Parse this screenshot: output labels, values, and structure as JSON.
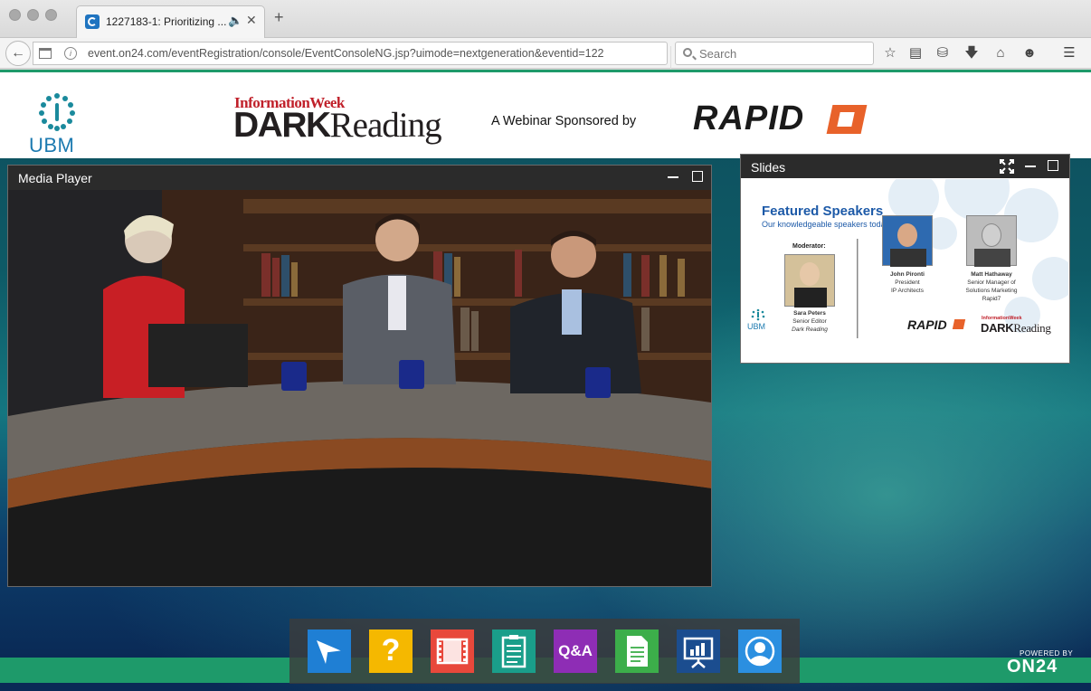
{
  "browser": {
    "tab_title": "1227183-1: Prioritizing ...",
    "tab_audio_icon": "speaker-icon",
    "url": "event.on24.com/eventRegistration/console/EventConsoleNG.jsp?uimode=nextgeneration&eventid=122",
    "search_placeholder": "Search",
    "toolbar_icons": [
      "bookmark-star-icon",
      "reading-list-icon",
      "pocket-icon",
      "downloads-icon",
      "home-icon",
      "emoji-icon",
      "menu-icon"
    ]
  },
  "header": {
    "ubm_label": "UBM",
    "informationweek_label": "InformationWeek",
    "dark_label": "DARK",
    "reading_label": "Reading",
    "sponsor_text": "A Webinar Sponsored by",
    "rapid7_label": "RAPID"
  },
  "media_player": {
    "title": "Media Player"
  },
  "slides": {
    "title": "Slides",
    "slide_title": "Featured Speakers",
    "slide_subtitle": "Our knowledgeable speakers today are:",
    "moderator_label": "Moderator:",
    "speakers": [
      {
        "name": "Sara Peters",
        "line1": "Senior Editor",
        "line2": "Dark Reading"
      },
      {
        "name": "John Pironti",
        "line1": "President",
        "line2": "IP Architects"
      },
      {
        "name": "Matt Hathaway",
        "line1": "Senior Manager of",
        "line2": "Solutions Marketing",
        "line3": "Rapid7"
      }
    ],
    "footer_ubm": "UBM",
    "footer_rapid7": "RAPID",
    "footer_iw": "InformationWeek",
    "footer_dark": "DARK",
    "footer_reading": "Reading"
  },
  "dock": {
    "buttons": [
      {
        "icon": "send-icon",
        "color": "#1f7fd4"
      },
      {
        "icon": "help-icon",
        "color": "#f5b800"
      },
      {
        "icon": "video-icon",
        "color": "#e8483b"
      },
      {
        "icon": "notes-icon",
        "color": "#1a9e8a"
      },
      {
        "icon": "qa-icon",
        "label": "Q&A",
        "color": "#8e2db5"
      },
      {
        "icon": "document-icon",
        "color": "#3cae4a"
      },
      {
        "icon": "slides-icon",
        "color": "#1b4d8f"
      },
      {
        "icon": "profile-icon",
        "color": "#2b8fe0"
      }
    ]
  },
  "footer": {
    "powered_by": "POWERED BY",
    "on24_label": "ON24"
  },
  "colors": {
    "accent_green": "#1e9a6a",
    "widget_header": "#2b2b2b"
  }
}
